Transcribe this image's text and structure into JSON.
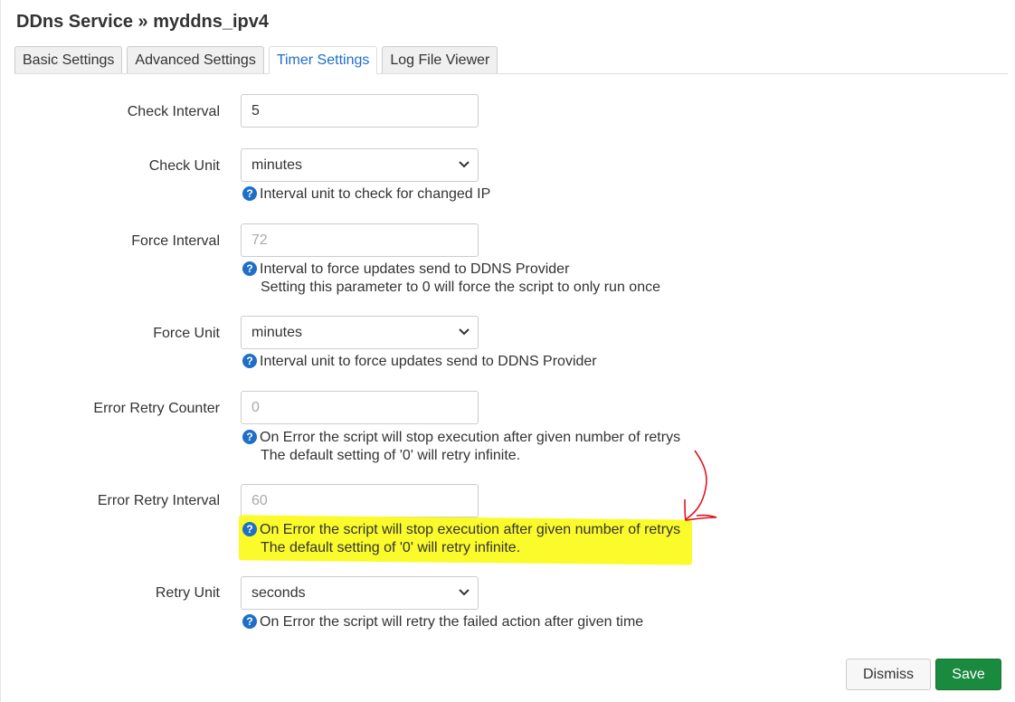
{
  "page": {
    "title": "DDns Service » myddns_ipv4"
  },
  "tabs": [
    {
      "label": "Basic Settings",
      "active": false
    },
    {
      "label": "Advanced Settings",
      "active": false
    },
    {
      "label": "Timer Settings",
      "active": true
    },
    {
      "label": "Log File Viewer",
      "active": false
    }
  ],
  "form": {
    "check_interval": {
      "label": "Check Interval",
      "value": "5"
    },
    "check_unit": {
      "label": "Check Unit",
      "value": "minutes",
      "hint": "Interval unit to check for changed IP"
    },
    "force_interval": {
      "label": "Force Interval",
      "placeholder": "72",
      "hint1": "Interval to force updates send to DDNS Provider",
      "hint2": "Setting this parameter to 0 will force the script to only run once"
    },
    "force_unit": {
      "label": "Force Unit",
      "value": "minutes",
      "hint": "Interval unit to force updates send to DDNS Provider"
    },
    "error_retry_counter": {
      "label": "Error Retry Counter",
      "placeholder": "0",
      "hint1": "On Error the script will stop execution after given number of retrys",
      "hint2": "The default setting of '0' will retry infinite."
    },
    "error_retry_interval": {
      "label": "Error Retry Interval",
      "placeholder": "60",
      "hint1": "On Error the script will stop execution after given number of retrys",
      "hint2": "The default setting of '0' will retry infinite."
    },
    "retry_unit": {
      "label": "Retry Unit",
      "value": "seconds",
      "hint": "On Error the script will retry the failed action after given time"
    }
  },
  "icons": {
    "help": "?"
  },
  "annotation": {
    "highlight_color": "#fbfb2c",
    "arrow_color": "#e0141e"
  },
  "actions": {
    "dismiss_label": "Dismiss",
    "save_label": "Save"
  },
  "colors": {
    "accent": "#1e6fc7",
    "save": "#1a8a3f"
  }
}
